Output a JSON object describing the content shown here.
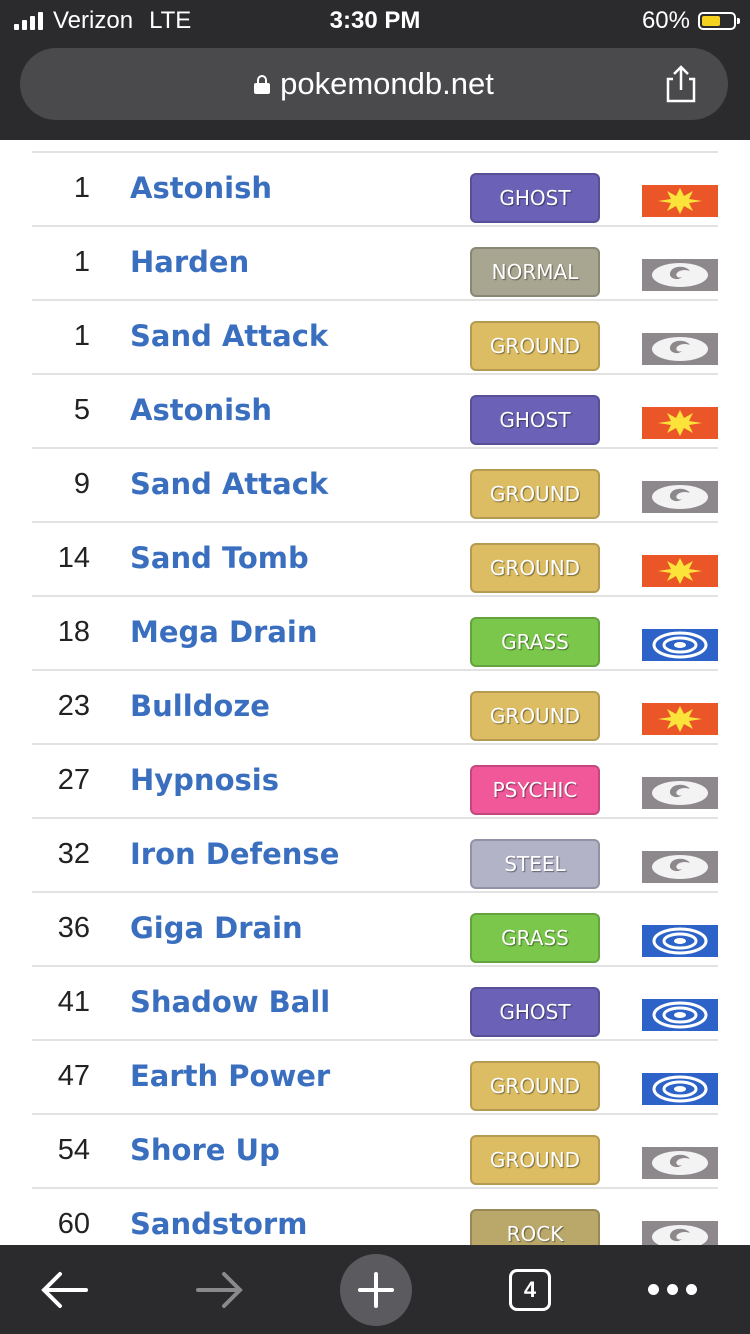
{
  "status_bar": {
    "carrier": "Verizon",
    "network": "LTE",
    "time": "3:30 PM",
    "battery_percent": "60%",
    "battery_level": 0.6,
    "battery_color": "#f5d21f"
  },
  "browser": {
    "url": "pokemondb.net",
    "share_icon": "share-icon",
    "lock_icon": "lock-icon"
  },
  "moves": [
    {
      "level": "1",
      "name": "Astonish",
      "type": "GHOST",
      "type_color": "#6b62b7",
      "category": "physical"
    },
    {
      "level": "1",
      "name": "Harden",
      "type": "NORMAL",
      "type_color": "#a8a690",
      "category": "status"
    },
    {
      "level": "1",
      "name": "Sand Attack",
      "type": "GROUND",
      "type_color": "#dcbd63",
      "category": "status"
    },
    {
      "level": "5",
      "name": "Astonish",
      "type": "GHOST",
      "type_color": "#6b62b7",
      "category": "physical"
    },
    {
      "level": "9",
      "name": "Sand Attack",
      "type": "GROUND",
      "type_color": "#dcbd63",
      "category": "status"
    },
    {
      "level": "14",
      "name": "Sand Tomb",
      "type": "GROUND",
      "type_color": "#dcbd63",
      "category": "physical"
    },
    {
      "level": "18",
      "name": "Mega Drain",
      "type": "GRASS",
      "type_color": "#7ac74c",
      "category": "special"
    },
    {
      "level": "23",
      "name": "Bulldoze",
      "type": "GROUND",
      "type_color": "#dcbd63",
      "category": "physical"
    },
    {
      "level": "27",
      "name": "Hypnosis",
      "type": "PSYCHIC",
      "type_color": "#f0589a",
      "category": "status"
    },
    {
      "level": "32",
      "name": "Iron Defense",
      "type": "STEEL",
      "type_color": "#b3b3c8",
      "category": "status"
    },
    {
      "level": "36",
      "name": "Giga Drain",
      "type": "GRASS",
      "type_color": "#7ac74c",
      "category": "special"
    },
    {
      "level": "41",
      "name": "Shadow Ball",
      "type": "GHOST",
      "type_color": "#6b62b7",
      "category": "special"
    },
    {
      "level": "47",
      "name": "Earth Power",
      "type": "GROUND",
      "type_color": "#dcbd63",
      "category": "special"
    },
    {
      "level": "54",
      "name": "Shore Up",
      "type": "GROUND",
      "type_color": "#dcbd63",
      "category": "status"
    },
    {
      "level": "60",
      "name": "Sandstorm",
      "type": "ROCK",
      "type_color": "#b9a86a",
      "category": "status"
    }
  ],
  "toolbar": {
    "back_icon": "back-arrow-icon",
    "forward_icon": "forward-arrow-icon",
    "new_tab_icon": "plus-icon",
    "tab_count": "4",
    "menu_icon": "more-icon"
  }
}
